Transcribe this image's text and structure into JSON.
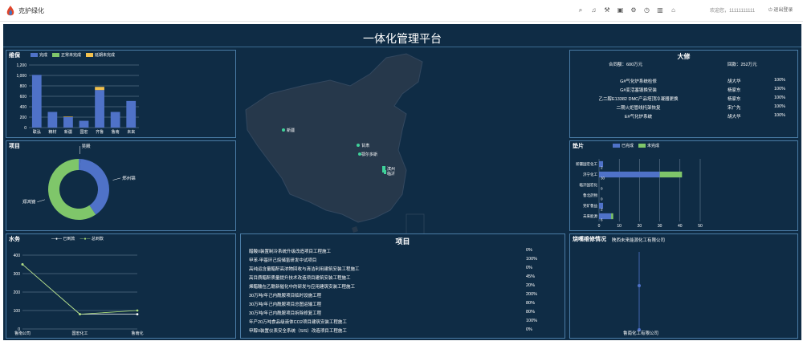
{
  "header": {
    "brand": "克护绿化",
    "welcome": "欢迎您，11111111111",
    "logout": "退出登录",
    "icons": [
      "search-icon",
      "bell-icon",
      "wrench-icon",
      "calendar-icon",
      "gear-icon",
      "clock-icon",
      "chart-icon",
      "home-icon"
    ]
  },
  "dashboard": {
    "title": "一体化管理平台"
  },
  "weibao": {
    "title": "维保",
    "legend": [
      "完成",
      "正常未完成",
      "延期未完成"
    ],
    "colors": {
      "done": "#4f72c8",
      "normal": "#7fc66a",
      "delay": "#f2c14e"
    }
  },
  "xiangmu_donut": {
    "title": "项目",
    "labels": [
      "吴殿",
      "郑州锦",
      "郑鸿锦"
    ]
  },
  "shuiwu": {
    "title": "水务",
    "legend": [
      "已到款",
      "总到款"
    ]
  },
  "map": {
    "labels": [
      "新疆",
      "甘肃",
      "鄂尔多斯",
      "滨州",
      "临沂"
    ]
  },
  "daxiu": {
    "title": "大修",
    "summary_contract": "合同额：600万元",
    "summary_amount": "回款：252万元",
    "rows": [
      {
        "name": "G#气化炉系统检修",
        "person": "胡大华",
        "pct": "100%"
      },
      {
        "name": "G#变活塞锻换安装",
        "person": "杨家东",
        "pct": "100%"
      },
      {
        "name": "乙二醇E13382 DMC产品塔顶冷凝器更换",
        "person": "杨家东",
        "pct": "100%"
      },
      {
        "name": "二期火炬管线托架恢复",
        "person": "宋广先",
        "pct": "100%"
      },
      {
        "name": "E#气化炉系统",
        "person": "胡大华",
        "pct": "100%"
      }
    ]
  },
  "dianpian": {
    "title": "垫片",
    "legend": [
      "已完成",
      "未完成"
    ]
  },
  "project_list": {
    "title": "项目",
    "rows": [
      {
        "name": "醋酸II装置制冷系统升级改造项目工程施工",
        "pct": "0%"
      },
      {
        "name": "甲苯-甲基环己烷储氢研发中试项目",
        "pct": "100%"
      },
      {
        "name": "高纯运含量醋酐高浓物回收与清洁利用建筑安装工程施工",
        "pct": "0%"
      },
      {
        "name": "高目质醋酐质量提升技术改造项目建筑安装工程施工",
        "pct": "45%"
      },
      {
        "name": "烯醋酸在乙酰新催化中的研发与应用建筑安装工程施工",
        "pct": "20%"
      },
      {
        "name": "30万吨/年己内酰胺项目临时设施工程",
        "pct": "200%"
      },
      {
        "name": "30万吨/年己内酰胺项目总图运输工程",
        "pct": "80%"
      },
      {
        "name": "30万吨/年己内酰胺项目拆除修复工程",
        "pct": "80%"
      },
      {
        "name": "年产20万吨食品级液体CO2项目建筑安装工程施工",
        "pct": "100%"
      },
      {
        "name": "甲醇II装置仪表安全系统（SIS）改造项目工程施工",
        "pct": "0%"
      }
    ]
  },
  "shaolou": {
    "title": "烧嘴维修情况",
    "company": "陕西未来能源化工有限公司",
    "bottom_label": "鲁南化工有限公司"
  },
  "chart_data": [
    {
      "type": "bar",
      "title": "维保",
      "categories": [
        "联泓",
        "精材",
        "新疆",
        "国宏",
        "齐鲁",
        "鲁南",
        "未来"
      ],
      "series": [
        {
          "name": "完成",
          "values": [
            1010,
            300,
            200,
            130,
            720,
            300,
            510
          ]
        },
        {
          "name": "正常未完成",
          "values": [
            0,
            0,
            0,
            0,
            0,
            0,
            0
          ]
        },
        {
          "name": "延期未完成",
          "values": [
            0,
            0,
            10,
            0,
            60,
            0,
            0
          ]
        }
      ],
      "ylim": [
        0,
        1200
      ],
      "yticks": [
        0,
        200,
        400,
        600,
        800,
        1000,
        1200
      ]
    },
    {
      "type": "pie",
      "title": "项目",
      "labels": [
        "吴殿",
        "郑州锦",
        "郑鸿锦"
      ],
      "values": [
        1,
        40,
        60
      ],
      "colors": [
        "#4f72c8",
        "#4f72c8",
        "#7fc66a"
      ]
    },
    {
      "type": "line",
      "title": "水务",
      "categories": [
        "鲁南公司",
        "国宏化工",
        "鲁南化"
      ],
      "series": [
        {
          "name": "已到款",
          "values": [
            350,
            80,
            80
          ]
        },
        {
          "name": "总到款",
          "values": [
            350,
            80,
            100
          ]
        }
      ],
      "ylim": [
        0,
        400
      ],
      "yticks": [
        0,
        100,
        200,
        300,
        400
      ]
    },
    {
      "type": "bar",
      "title": "垫片",
      "orientation": "horizontal",
      "categories": [
        "新疆国宏化工",
        "济宁化工",
        "临沂国宏化",
        "鲁北药物",
        "兖矿鲁益",
        "未来能源"
      ],
      "series": [
        {
          "name": "已完成",
          "values": [
            2,
            30,
            0,
            0,
            2,
            6
          ]
        },
        {
          "name": "未完成",
          "values": [
            0,
            11,
            0,
            0,
            0,
            1
          ]
        }
      ],
      "data_labels": [
        "2",
        "30",
        "0",
        "0",
        "2",
        "6"
      ],
      "xlim": [
        0,
        50
      ],
      "xticks": [
        0,
        10,
        20,
        30,
        40,
        50
      ]
    }
  ]
}
